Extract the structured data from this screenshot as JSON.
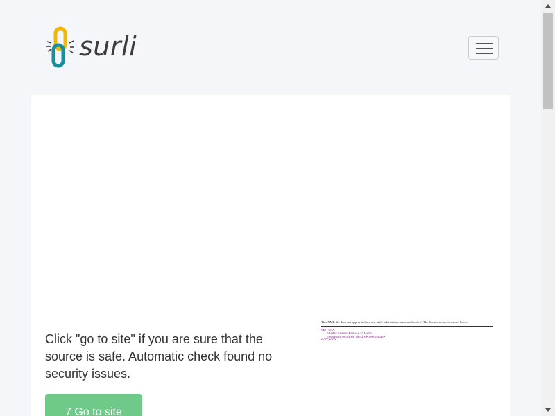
{
  "brand": {
    "name": "surli",
    "colors": {
      "teal": "#1a8f9c",
      "yellow": "#f2b705",
      "text": "#3c3c3c"
    }
  },
  "header": {
    "menu_icon": "hamburger-icon"
  },
  "main": {
    "message": "Click \"go to site\" if you are sure that the source is safe. Automatic check found no security issues.",
    "go_button": "7 Go to site",
    "button_color": "#6fca8a"
  },
  "preview": {
    "note": "This XML file does not appear to have any style information associated with it. The document tree is shown below.",
    "xml_lines": [
      "<Error>",
      "<Code>AccessDenied</Code>",
      "<Message>Access denied</Message>",
      "</Error>"
    ]
  }
}
